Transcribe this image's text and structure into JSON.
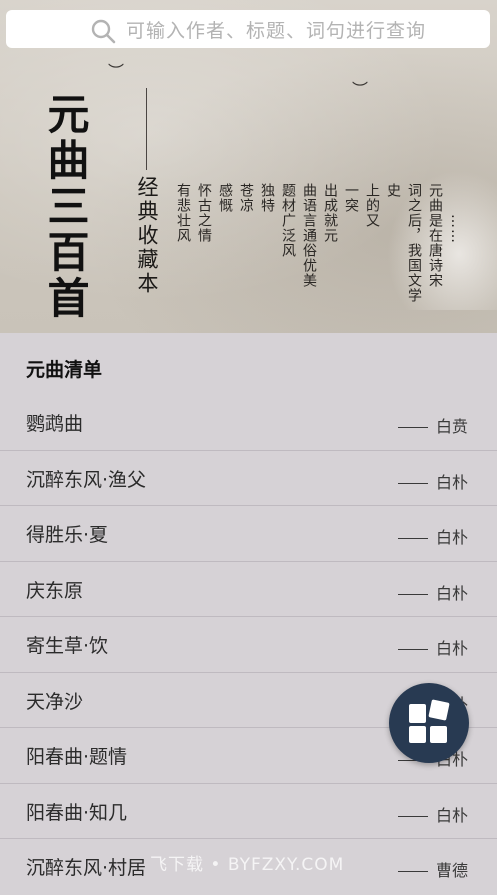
{
  "search": {
    "placeholder": "可输入作者、标题、词句进行查询",
    "icon": "search-icon"
  },
  "hero": {
    "title": "元曲三百首",
    "subtitle": "经典收藏本",
    "intro_columns": [
      "元曲是在唐诗宋",
      "词之后，我国文学史",
      "上的又",
      "一突",
      "出成就元",
      "曲语言通俗优美",
      "题材广泛风",
      "独特",
      "苍凉",
      "感慨",
      "怀古之情",
      "有悲壮风"
    ],
    "more": "……"
  },
  "list": {
    "header": "元曲清单",
    "items": [
      {
        "title": "鹦鹉曲",
        "author": "白贲"
      },
      {
        "title": "沉醉东风·渔父",
        "author": "白朴"
      },
      {
        "title": "得胜乐·夏",
        "author": "白朴"
      },
      {
        "title": "庆东原",
        "author": "白朴"
      },
      {
        "title": "寄生草·饮",
        "author": "白朴"
      },
      {
        "title": "天净沙",
        "author": "白朴"
      },
      {
        "title": "阳春曲·题情",
        "author": "白朴"
      },
      {
        "title": "阳春曲·知几",
        "author": "白朴"
      },
      {
        "title": "沉醉东风·村居",
        "author": "曹德"
      }
    ]
  },
  "fab": {
    "icon": "grid-blocks-icon"
  },
  "watermark": "飞下载 • BYFZXY.COM",
  "colors": {
    "fab": "#283a52",
    "list_bg": "#d6d2d6"
  }
}
